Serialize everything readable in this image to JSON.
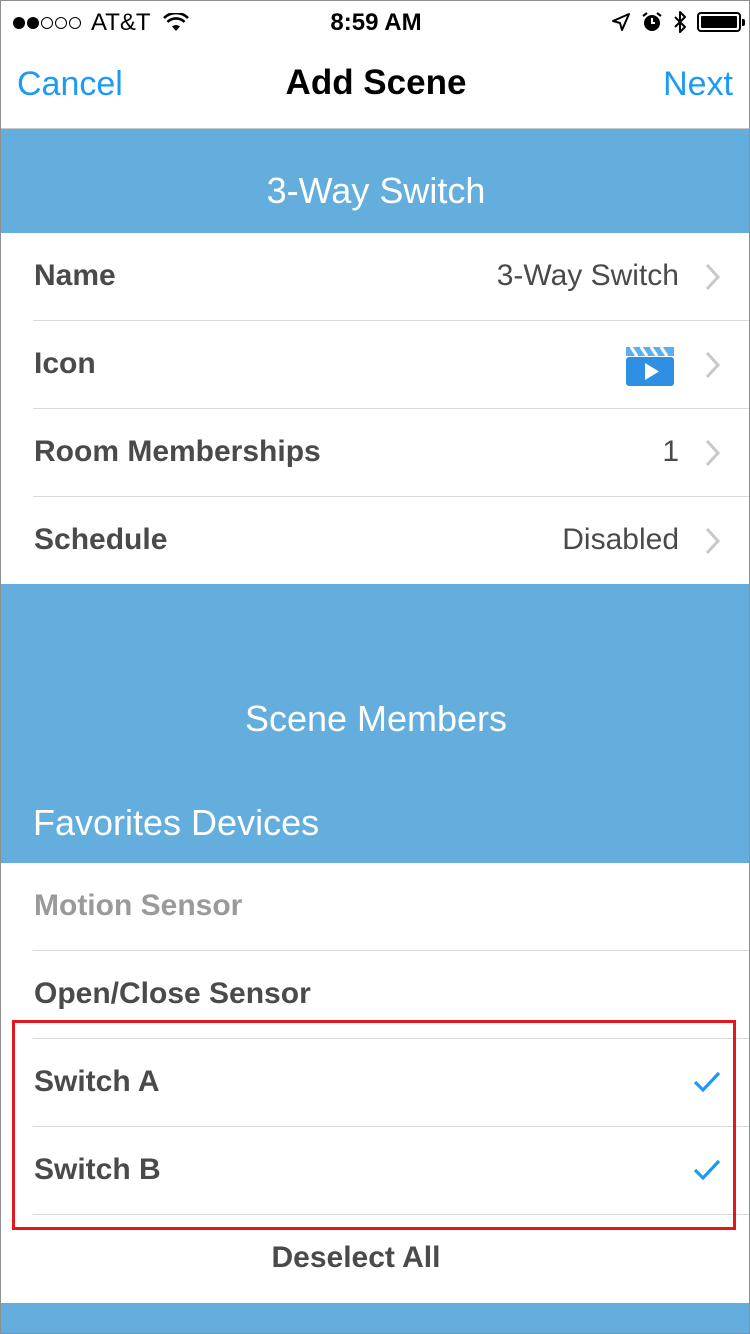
{
  "status_bar": {
    "carrier": "AT&T",
    "time": "8:59 AM",
    "signal_filled": 2,
    "signal_total": 5
  },
  "nav": {
    "cancel_label": "Cancel",
    "title": "Add Scene",
    "next_label": "Next"
  },
  "scene_header": "3-Way Switch",
  "settings": [
    {
      "label": "Name",
      "value": "3-Way Switch"
    },
    {
      "label": "Icon",
      "value": "",
      "icon": "clapperboard-play-icon"
    },
    {
      "label": "Room Memberships",
      "value": "1"
    },
    {
      "label": "Schedule",
      "value": "Disabled"
    }
  ],
  "members_header": "Scene Members",
  "favorites_header": "Favorites Devices",
  "devices": [
    {
      "label": "Motion Sensor",
      "selected": false,
      "dimmed": true
    },
    {
      "label": "Open/Close Sensor",
      "selected": false,
      "dimmed": false
    },
    {
      "label": "Switch A",
      "selected": true,
      "dimmed": false
    },
    {
      "label": "Switch B",
      "selected": true,
      "dimmed": false
    }
  ],
  "deselect_label": "Deselect All",
  "colors": {
    "accent": "#1b9af7",
    "band": "#64aedd",
    "highlight": "#e3171c"
  }
}
